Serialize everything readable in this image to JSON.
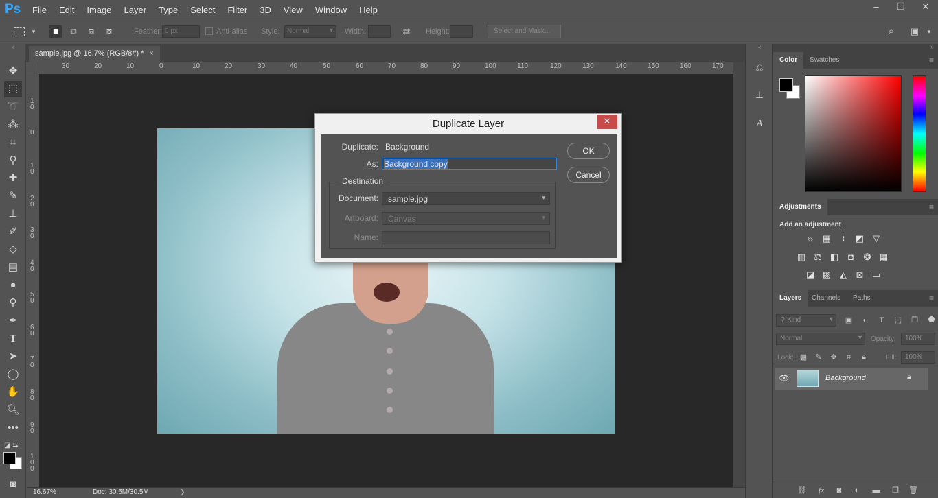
{
  "app": {
    "logo": "Ps"
  },
  "menubar": {
    "items": [
      "File",
      "Edit",
      "Image",
      "Layer",
      "Type",
      "Select",
      "Filter",
      "3D",
      "View",
      "Window",
      "Help"
    ]
  },
  "window_controls": {
    "minimize": "‒",
    "restore": "❐",
    "close": "✕"
  },
  "options": {
    "feather_label": "Feather:",
    "feather_value": "0 px",
    "antialias_label": "Anti-alias",
    "style_label": "Style:",
    "style_value": "Normal",
    "width_label": "Width:",
    "height_label": "Height:",
    "select_mask_label": "Select and Mask..."
  },
  "document": {
    "tab_title": "sample.jpg @ 16.7% (RGB/8#) *",
    "tab_close": "×",
    "zoom": "16.67%",
    "doc_size": "Doc: 30.5M/30.5M",
    "status_arrow": "❯"
  },
  "ruler": {
    "h_labels": [
      "30",
      "20",
      "10",
      "0",
      "10",
      "20",
      "30",
      "40",
      "50",
      "60",
      "70",
      "80",
      "90",
      "100",
      "110",
      "120",
      "130",
      "140",
      "150",
      "160",
      "170"
    ],
    "v_labels": [
      "1 0",
      "0",
      "1 0",
      "2 0",
      "3 0",
      "4 0",
      "5 0",
      "6 0",
      "7 0",
      "8 0",
      "9 0",
      "1 0 0"
    ]
  },
  "dialog": {
    "title": "Duplicate Layer",
    "close": "✕",
    "duplicate_label": "Duplicate:",
    "duplicate_value": "Background",
    "as_label": "As:",
    "as_value": "Background copy",
    "destination_label": "Destination",
    "document_label": "Document:",
    "document_value": "sample.jpg",
    "artboard_label": "Artboard:",
    "artboard_value": "Canvas",
    "name_label": "Name:",
    "name_value": "",
    "ok_label": "OK",
    "cancel_label": "Cancel",
    "dropdown_arrow": "▾"
  },
  "panels": {
    "color_tab": "Color",
    "swatches_tab": "Swatches",
    "adjustments_tab": "Adjustments",
    "add_adjustment": "Add an adjustment",
    "layers_tab": "Layers",
    "channels_tab": "Channels",
    "paths_tab": "Paths",
    "kind_placeholder": "Kind",
    "blend_mode": "Normal",
    "opacity_label": "Opacity:",
    "opacity_value": "100%",
    "lock_label": "Lock:",
    "fill_label": "Fill:",
    "fill_value": "100%",
    "layer_name": "Background",
    "panel_menu": "≡"
  },
  "colors": {
    "ui_bg": "#535353",
    "canvas_bg": "#282828",
    "selection_blue": "#3a71c1",
    "close_red": "#c94a4a",
    "foreground": "#000000",
    "background": "#ffffff"
  }
}
